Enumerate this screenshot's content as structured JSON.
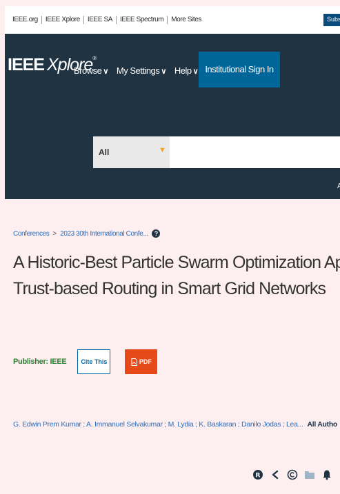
{
  "topbar": {
    "links": [
      "IEEE.org",
      "IEEE Xplore",
      "IEEE SA",
      "IEEE Spectrum",
      "More Sites"
    ],
    "subscribe_label": "Subs"
  },
  "header": {
    "logo_main": "IEEE",
    "logo_sub": "Xplore",
    "logo_mark": "®",
    "nav": [
      "Browse",
      "My Settings",
      "Help"
    ],
    "signin_label": "Institutional Sign In",
    "search_scope": "All",
    "advanced_label": "A"
  },
  "breadcrumb": {
    "items": [
      "Conferences",
      "2023 30th International Confe..."
    ],
    "separator": ">"
  },
  "article": {
    "title_line1": "A Historic-Best Particle Swarm Optimization Approach for",
    "title_line2": "Trust-based Routing in Smart Grid Networks",
    "publisher": "Publisher: IEEE",
    "cite_label": "Cite This",
    "pdf_label": "PDF",
    "authors": "G. Edwin Prem Kumar ; A. Immanuel Selvakumar ; M. Lydia ; K. Baskaran ; Danilo Jodas ; Lea...",
    "all_authors_label": "All Autho"
  },
  "colors": {
    "accent": "#006699",
    "header_bg": "#1f3343",
    "pdf": "#e64a19",
    "publisher": "#2e7d32",
    "link": "#2a6ebb"
  },
  "icons": [
    "help-icon",
    "chevron-down-icon",
    "caret-down-icon",
    "pdf-icon",
    "rights-icon",
    "share-icon",
    "copyright-icon",
    "folder-icon",
    "alert-icon"
  ]
}
